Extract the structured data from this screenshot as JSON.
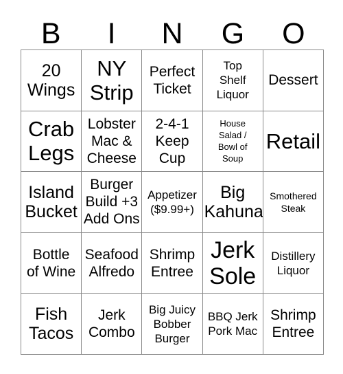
{
  "card": {
    "title": "Bingo Card",
    "header_letters": [
      "B",
      "I",
      "N",
      "G",
      "O"
    ],
    "colors": {
      "background": "#ffffff",
      "text": "#000000",
      "grid_line": "#888888"
    },
    "rows": [
      {
        "cells": [
          {
            "text": "20\nWings",
            "size": "lg"
          },
          {
            "text": "NY\nStrip",
            "size": "xl"
          },
          {
            "text": "Perfect\nTicket",
            "size": "md"
          },
          {
            "text": "Top\nShelf\nLiquor",
            "size": "sm"
          },
          {
            "text": "Dessert",
            "size": "md"
          }
        ]
      },
      {
        "cells": [
          {
            "text": "Crab\nLegs",
            "size": "xl"
          },
          {
            "text": "Lobster\nMac &\nCheese",
            "size": "md"
          },
          {
            "text": "2-4-1\nKeep\nCup",
            "size": "md"
          },
          {
            "text": "House\nSalad /\nBowl of\nSoup",
            "size": "xxs"
          },
          {
            "text": "Retail",
            "size": "xl"
          }
        ]
      },
      {
        "cells": [
          {
            "text": "Island\nBucket",
            "size": "lg"
          },
          {
            "text": "Burger\nBuild +3\nAdd Ons",
            "size": "md"
          },
          {
            "text": "Appetizer\n($9.99+)",
            "size": "sm"
          },
          {
            "text": "Big\nKahuna",
            "size": "lg"
          },
          {
            "text": "Smothered\nSteak",
            "size": "xs"
          }
        ]
      },
      {
        "cells": [
          {
            "text": "Bottle\nof Wine",
            "size": "md"
          },
          {
            "text": "Seafood\nAlfredo",
            "size": "md"
          },
          {
            "text": "Shrimp\nEntree",
            "size": "md"
          },
          {
            "text": "Jerk\nSole",
            "size": "xxl"
          },
          {
            "text": "Distillery\nLiquor",
            "size": "sm"
          }
        ]
      },
      {
        "cells": [
          {
            "text": "Fish\nTacos",
            "size": "lg"
          },
          {
            "text": "Jerk\nCombo",
            "size": "md"
          },
          {
            "text": "Big Juicy\nBobber\nBurger",
            "size": "sm"
          },
          {
            "text": "BBQ Jerk\nPork Mac",
            "size": "sm"
          },
          {
            "text": "Shrimp\nEntree",
            "size": "md"
          }
        ]
      }
    ]
  }
}
